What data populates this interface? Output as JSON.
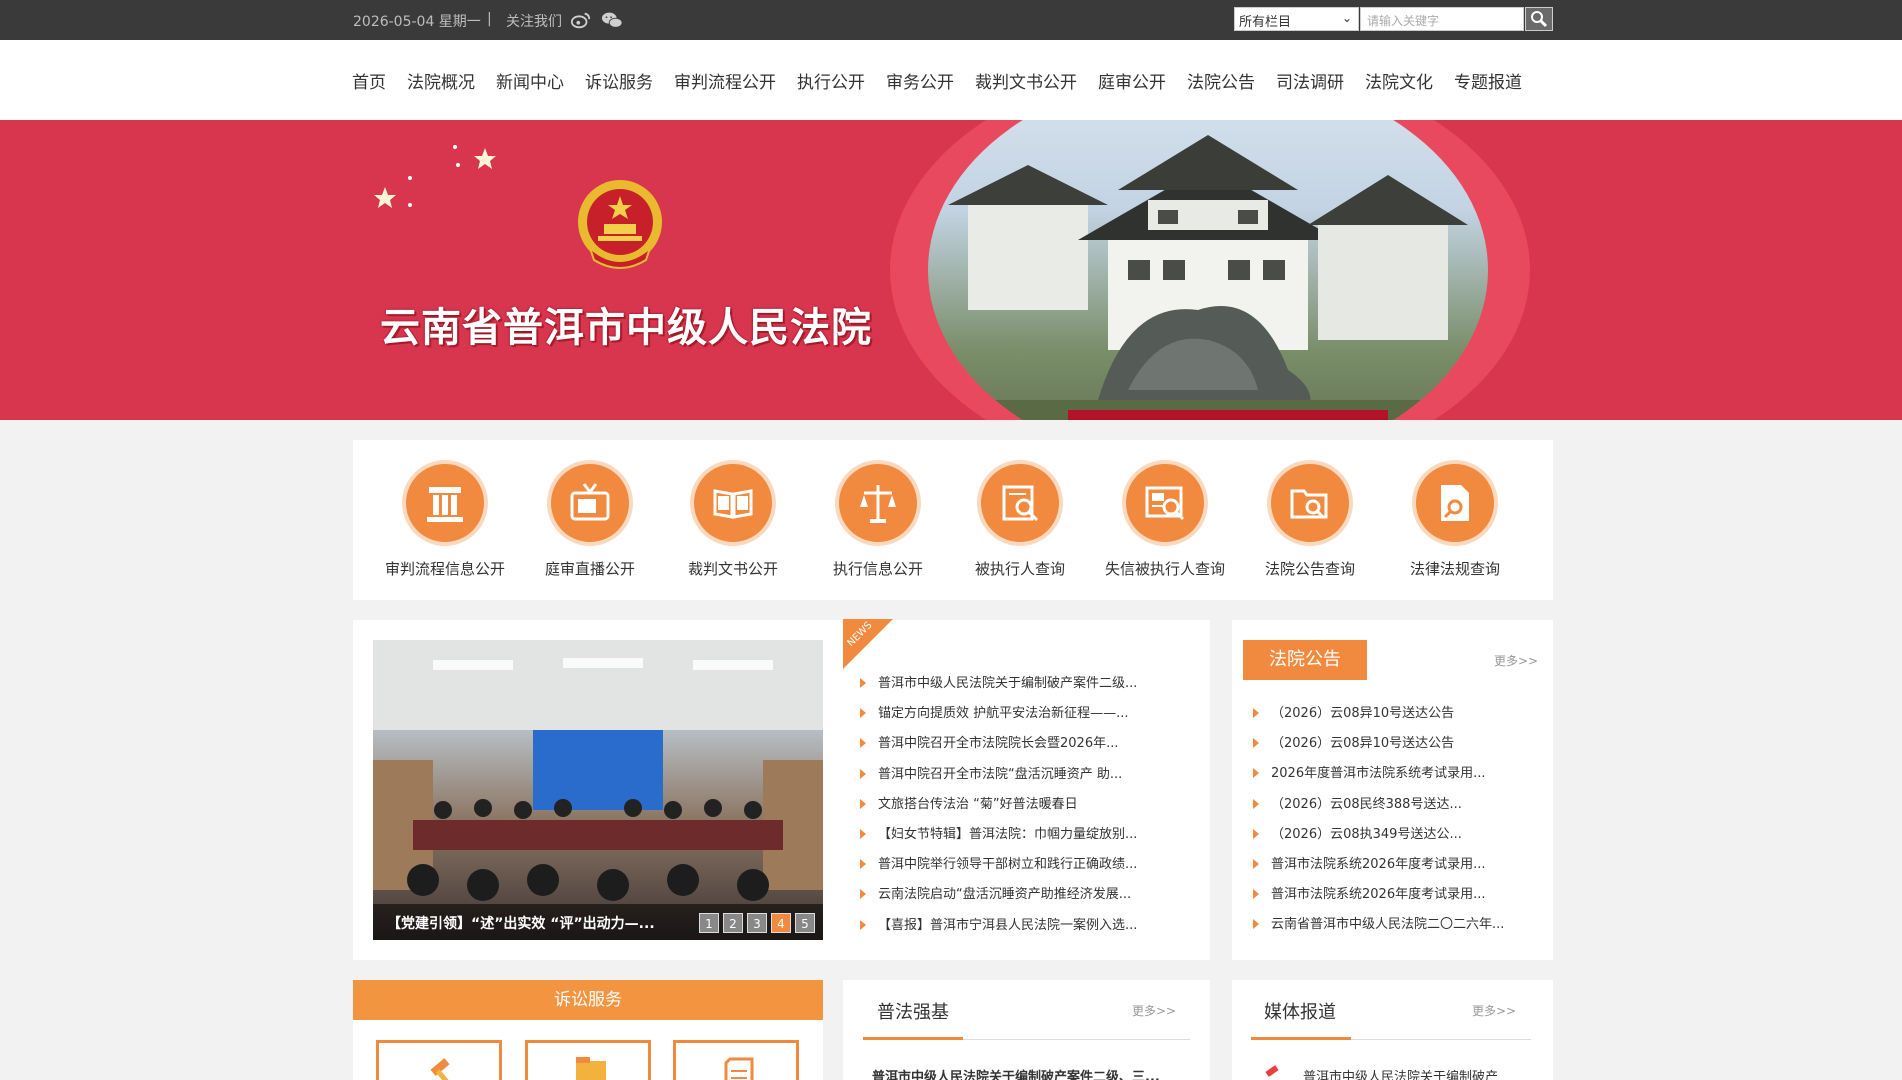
{
  "topbar": {
    "date": "2026-05-04 星期一",
    "separator": "|",
    "follow_label": "关注我们",
    "weibo_icon": "weibo-icon",
    "wechat_icon": "wechat-icon",
    "search_scope": "所有栏目",
    "search_placeholder": "请输入关键字",
    "search_icon": "magnifier-icon"
  },
  "nav": [
    "首页",
    "法院概况",
    "新闻中心",
    "诉讼服务",
    "审判流程公开",
    "执行公开",
    "审务公开",
    "裁判文书公开",
    "庭审公开",
    "法院公告",
    "司法调研",
    "法院文化",
    "专题报道"
  ],
  "banner": {
    "title": "云南省普洱市中级人民法院",
    "emblem": "national-emblem-icon",
    "colors": {
      "background": "#d8354f",
      "ring": "#e8495f"
    }
  },
  "quick_links": [
    {
      "label": "审判流程信息公开",
      "icon": "pillar-icon"
    },
    {
      "label": "庭审直播公开",
      "icon": "tv-icon"
    },
    {
      "label": "裁判文书公开",
      "icon": "book-icon"
    },
    {
      "label": "执行信息公开",
      "icon": "scales-icon"
    },
    {
      "label": "被执行人查询",
      "icon": "document-search-icon"
    },
    {
      "label": "失信被执行人查询",
      "icon": "news-search-icon"
    },
    {
      "label": "法院公告查询",
      "icon": "folder-search-icon"
    },
    {
      "label": "法律法规查询",
      "icon": "file-search-icon"
    }
  ],
  "news": {
    "tag": "NEWS",
    "photo_caption": "【党建引领】“述”出实效 “评”出动力—...",
    "pages": [
      "1",
      "2",
      "3",
      "4",
      "5"
    ],
    "active_page": "4",
    "items": [
      "普洱市中级人民法院关于编制破产案件二级...",
      "锚定方向提质效 护航平安法治新征程——...",
      "普洱中院召开全市法院院长会暨2026年...",
      "普洱中院召开全市法院“盘活沉睡资产 助...",
      "文旅搭台传法治 “菊”好普法暖春日",
      "【妇女节特辑】普洱法院：巾帼力量绽放别...",
      "普洱中院举行领导干部树立和践行正确政绩...",
      "云南法院启动“盘活沉睡资产助推经济发展...",
      "【喜报】普洱市宁洱县人民法院一案例入选..."
    ]
  },
  "notice": {
    "title": "法院公告",
    "more": "更多>>",
    "items": [
      "（2026）云08异10号送达公告",
      "（2026）云08异10号送达公告",
      "2026年度普洱市法院系统考试录用...",
      "（2026）云08民终388号送达...",
      "（2026）云08执349号送达公...",
      "普洱市法院系统2026年度考试录用...",
      "普洱市法院系统2026年度考试录用...",
      "云南省普洱市中级人民法院二〇二六年..."
    ]
  },
  "bottom": {
    "litigation_title": "诉讼服务",
    "pufa_title": "普法强基",
    "pufa_more": "更多>>",
    "pufa_first": "普洱市中级人民法院关于编制破产案件二级、三...",
    "media_title": "媒体报道",
    "media_more": "更多>>",
    "media_first": "普洱市中级人民法院关于编制破产"
  }
}
